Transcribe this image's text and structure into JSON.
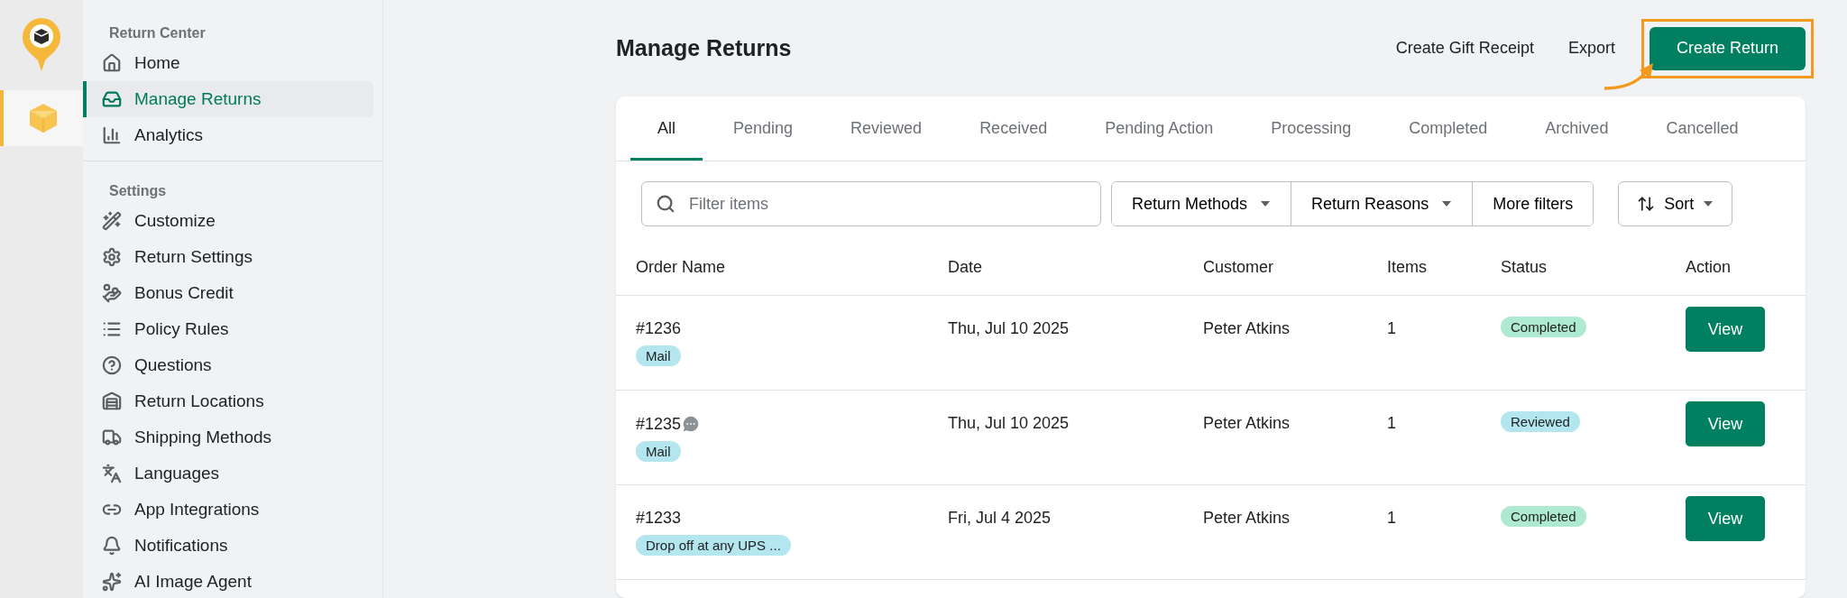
{
  "sidebar": {
    "sections": [
      {
        "title": "Return Center",
        "items": [
          {
            "label": "Home",
            "selected": false
          },
          {
            "label": "Manage Returns",
            "selected": true
          },
          {
            "label": "Analytics",
            "selected": false
          }
        ]
      },
      {
        "title": "Settings",
        "items": [
          {
            "label": "Customize",
            "selected": false
          },
          {
            "label": "Return Settings",
            "selected": false
          },
          {
            "label": "Bonus Credit",
            "selected": false
          },
          {
            "label": "Policy Rules",
            "selected": false
          },
          {
            "label": "Questions",
            "selected": false
          },
          {
            "label": "Return Locations",
            "selected": false
          },
          {
            "label": "Shipping Methods",
            "selected": false
          },
          {
            "label": "Languages",
            "selected": false
          },
          {
            "label": "App Integrations",
            "selected": false
          },
          {
            "label": "Notifications",
            "selected": false
          },
          {
            "label": "AI Image Agent",
            "selected": false
          }
        ]
      }
    ]
  },
  "page": {
    "title": "Manage Returns",
    "actions": [
      {
        "label": "Create Gift Receipt",
        "kind": "plain",
        "highlighted": false
      },
      {
        "label": "Export",
        "kind": "plain",
        "highlighted": false
      },
      {
        "label": "Create Return",
        "kind": "primary",
        "highlighted": true
      }
    ]
  },
  "tabs": [
    {
      "label": "All",
      "selected": true
    },
    {
      "label": "Pending",
      "selected": false
    },
    {
      "label": "Reviewed",
      "selected": false
    },
    {
      "label": "Received",
      "selected": false
    },
    {
      "label": "Pending Action",
      "selected": false
    },
    {
      "label": "Processing",
      "selected": false
    },
    {
      "label": "Completed",
      "selected": false
    },
    {
      "label": "Archived",
      "selected": false
    },
    {
      "label": "Cancelled",
      "selected": false
    }
  ],
  "search": {
    "placeholder": "Filter items"
  },
  "filters": [
    {
      "label": "Return Methods",
      "dropdown": true
    },
    {
      "label": "Return Reasons",
      "dropdown": true
    },
    {
      "label": "More filters",
      "dropdown": false
    }
  ],
  "sort": {
    "label": "Sort"
  },
  "table": {
    "columns": [
      "Order Name",
      "Date",
      "Customer",
      "Items",
      "Status",
      "Action"
    ],
    "rows": [
      {
        "order": "#1236",
        "has_note": false,
        "method": "Mail",
        "date": "Thu, Jul 10 2025",
        "customer": "Peter Atkins",
        "items": "1",
        "status": {
          "label": "Completed",
          "color": "#aee9d1"
        },
        "action": "View"
      },
      {
        "order": "#1235",
        "has_note": true,
        "method": "Mail",
        "date": "Thu, Jul 10 2025",
        "customer": "Peter Atkins",
        "items": "1",
        "status": {
          "label": "Reviewed",
          "color": "#b4e6ef"
        },
        "action": "View"
      },
      {
        "order": "#1233",
        "has_note": false,
        "method": "Drop off at any UPS ...",
        "date": "Fri, Jul 4 2025",
        "customer": "Peter Atkins",
        "items": "1",
        "status": {
          "label": "Completed",
          "color": "#aee9d1"
        },
        "action": "View"
      }
    ]
  }
}
